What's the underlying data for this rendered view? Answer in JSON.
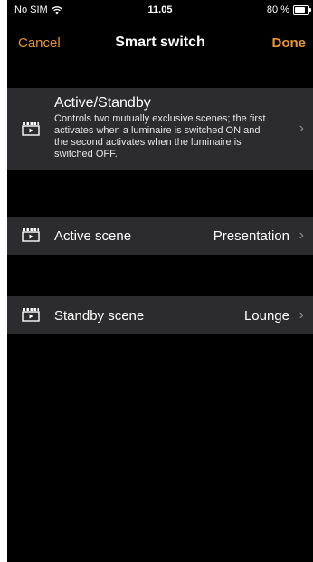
{
  "status_bar": {
    "carrier": "No SIM",
    "time": "11.05",
    "battery_text": "80 %",
    "battery_level": 0.8,
    "wifi_icon": "wifi-icon"
  },
  "nav": {
    "cancel_label": "Cancel",
    "title": "Smart switch",
    "done_label": "Done"
  },
  "mode": {
    "title": "Active/Standby",
    "description": "Controls two mutually exclusive scenes; the first activates when a luminaire is switched ON and the second activates when the luminaire is switched OFF."
  },
  "scenes": {
    "active": {
      "label": "Active scene",
      "value": "Presentation"
    },
    "standby": {
      "label": "Standby scene",
      "value": "Lounge"
    }
  },
  "colors": {
    "accent": "#e8952c",
    "background": "#000000",
    "cell": "#2c2c2e",
    "chevron": "#8e8e93"
  }
}
